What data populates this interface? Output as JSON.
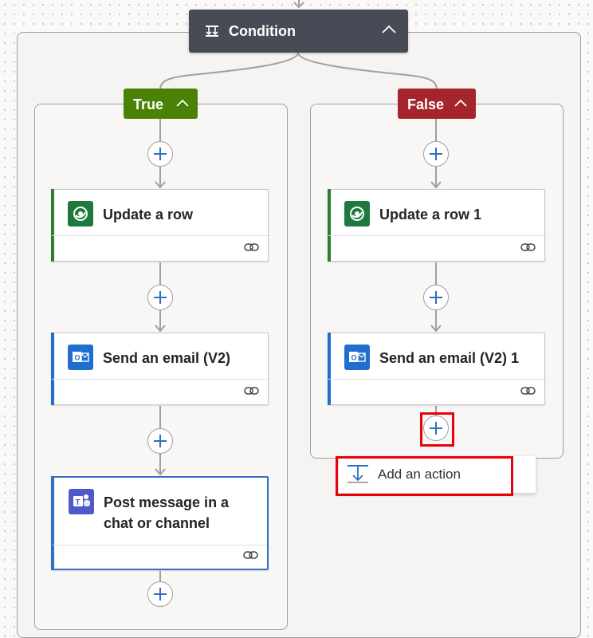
{
  "condition": {
    "title": "Condition",
    "icon": "condition-icon",
    "header_color": "#474b55"
  },
  "branches": {
    "true": {
      "label": "True",
      "color": "#498205"
    },
    "false": {
      "label": "False",
      "color": "#a4262c"
    }
  },
  "true_actions": [
    {
      "title": "Update a row",
      "icon": "dataverse-icon",
      "accent": "#2e7d32"
    },
    {
      "title": "Send an email (V2)",
      "icon": "outlook-icon",
      "accent": "#1f6fd0"
    },
    {
      "title_line1": "Post message in a",
      "title_line2": "chat or channel",
      "icon": "teams-icon",
      "accent": "#2f6fc4"
    }
  ],
  "false_actions": [
    {
      "title": "Update a row 1",
      "icon": "dataverse-icon",
      "accent": "#2e7d32"
    },
    {
      "title": "Send an email (V2) 1",
      "icon": "outlook-icon",
      "accent": "#1f6fd0"
    }
  ],
  "menu": {
    "add_action_label": "Add an action",
    "icon": "add-action-icon"
  },
  "highlight_color": "#e8000a"
}
